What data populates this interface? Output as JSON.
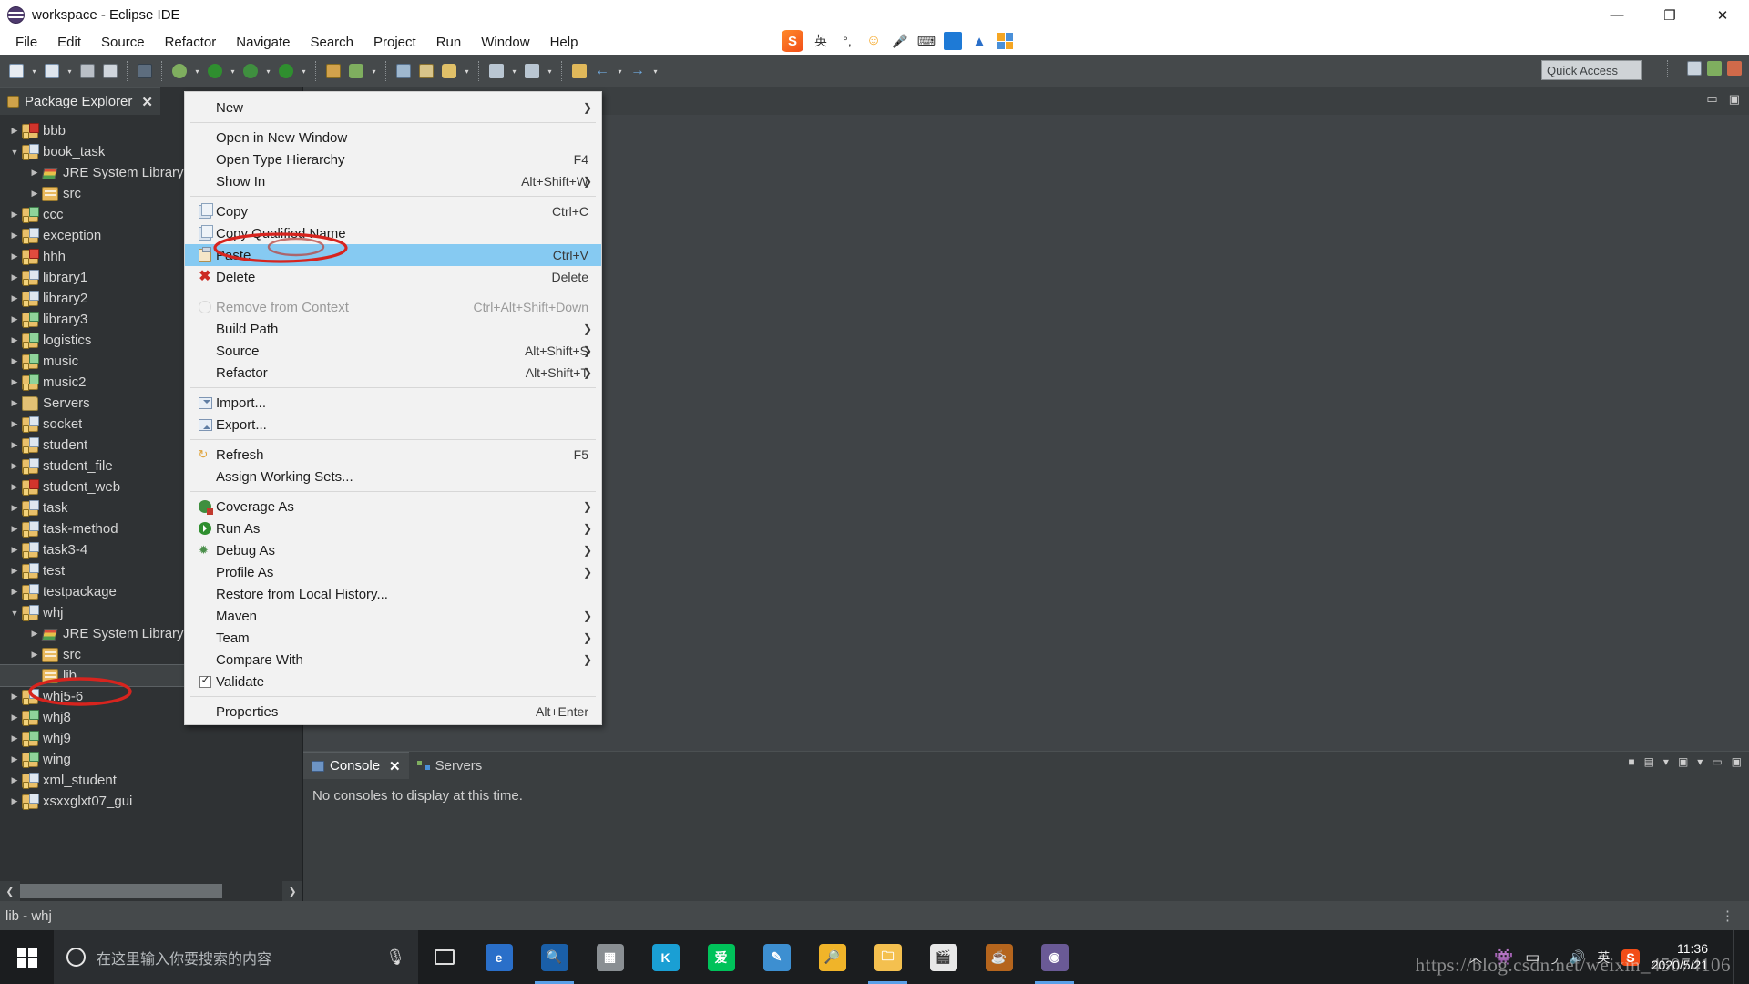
{
  "window": {
    "title": "workspace - Eclipse IDE",
    "minimize": "—",
    "maximize": "❐",
    "close": "✕"
  },
  "menubar": {
    "items": [
      "File",
      "Edit",
      "Source",
      "Refactor",
      "Navigate",
      "Search",
      "Project",
      "Run",
      "Window",
      "Help"
    ]
  },
  "toolbar": {
    "quick_access_placeholder": "Quick Access"
  },
  "ime": {
    "logo": "S",
    "mode": "英",
    "punct": "°,",
    "emoji": "☺",
    "mic": "🎤",
    "keyboard": "⌨",
    "toolbox": "⊞"
  },
  "explorer": {
    "tab_label": "Package Explorer",
    "tab_close": "✕",
    "tree": [
      {
        "label": "bbb",
        "depth": 0,
        "twist": "collapsed",
        "icon": "project-error-icon"
      },
      {
        "label": "book_task",
        "depth": 0,
        "twist": "expanded",
        "icon": "project-icon"
      },
      {
        "label": "JRE System Library",
        "depth": 1,
        "twist": "collapsed",
        "icon": "jre-library-icon"
      },
      {
        "label": "src",
        "depth": 1,
        "twist": "collapsed",
        "icon": "source-folder-icon"
      },
      {
        "label": "ccc",
        "depth": 0,
        "twist": "collapsed",
        "icon": "project-web-icon"
      },
      {
        "label": "exception",
        "depth": 0,
        "twist": "collapsed",
        "icon": "project-icon"
      },
      {
        "label": "hhh",
        "depth": 0,
        "twist": "collapsed",
        "icon": "project-warn-icon"
      },
      {
        "label": "library1",
        "depth": 0,
        "twist": "collapsed",
        "icon": "project-icon"
      },
      {
        "label": "library2",
        "depth": 0,
        "twist": "collapsed",
        "icon": "project-icon"
      },
      {
        "label": "library3",
        "depth": 0,
        "twist": "collapsed",
        "icon": "project-web-icon"
      },
      {
        "label": "logistics",
        "depth": 0,
        "twist": "collapsed",
        "icon": "project-web-icon"
      },
      {
        "label": "music",
        "depth": 0,
        "twist": "collapsed",
        "icon": "project-web-icon"
      },
      {
        "label": "music2",
        "depth": 0,
        "twist": "collapsed",
        "icon": "project-web-icon"
      },
      {
        "label": "Servers",
        "depth": 0,
        "twist": "collapsed",
        "icon": "folder-icon"
      },
      {
        "label": "socket",
        "depth": 0,
        "twist": "collapsed",
        "icon": "project-icon"
      },
      {
        "label": "student",
        "depth": 0,
        "twist": "collapsed",
        "icon": "project-icon"
      },
      {
        "label": "student_file",
        "depth": 0,
        "twist": "collapsed",
        "icon": "project-icon"
      },
      {
        "label": "student_web",
        "depth": 0,
        "twist": "collapsed",
        "icon": "project-error-icon"
      },
      {
        "label": "task",
        "depth": 0,
        "twist": "collapsed",
        "icon": "project-icon"
      },
      {
        "label": "task-method",
        "depth": 0,
        "twist": "collapsed",
        "icon": "project-icon"
      },
      {
        "label": "task3-4",
        "depth": 0,
        "twist": "collapsed",
        "icon": "project-icon"
      },
      {
        "label": "test",
        "depth": 0,
        "twist": "collapsed",
        "icon": "project-icon"
      },
      {
        "label": "testpackage",
        "depth": 0,
        "twist": "collapsed",
        "icon": "project-icon"
      },
      {
        "label": "whj",
        "depth": 0,
        "twist": "expanded",
        "icon": "project-icon"
      },
      {
        "label": "JRE System Library",
        "depth": 1,
        "twist": "collapsed",
        "icon": "jre-library-icon"
      },
      {
        "label": "src",
        "depth": 1,
        "twist": "collapsed",
        "icon": "source-folder-icon"
      },
      {
        "label": "lib",
        "depth": 1,
        "twist": "none",
        "icon": "source-folder-icon",
        "selected": true
      },
      {
        "label": "whj5-6",
        "depth": 0,
        "twist": "collapsed",
        "icon": "project-icon"
      },
      {
        "label": "whj8",
        "depth": 0,
        "twist": "collapsed",
        "icon": "project-web-icon"
      },
      {
        "label": "whj9",
        "depth": 0,
        "twist": "collapsed",
        "icon": "project-web-icon"
      },
      {
        "label": "wing",
        "depth": 0,
        "twist": "collapsed",
        "icon": "project-web-icon"
      },
      {
        "label": "xml_student",
        "depth": 0,
        "twist": "collapsed",
        "icon": "project-icon"
      },
      {
        "label": "xsxxglxt07_gui",
        "depth": 0,
        "twist": "collapsed",
        "icon": "project-icon"
      }
    ],
    "hscroll_left": "❮",
    "hscroll_right": "❯"
  },
  "context_menu": {
    "items": [
      {
        "label": "New",
        "accel": "",
        "submenu": true,
        "icon": "",
        "id": "new"
      },
      {
        "separator": true
      },
      {
        "label": "Open in New Window",
        "accel": "",
        "submenu": false,
        "icon": "",
        "id": "open-in-new-window"
      },
      {
        "label": "Open Type Hierarchy",
        "accel": "F4",
        "submenu": false,
        "icon": "",
        "id": "open-type-hierarchy"
      },
      {
        "label": "Show In",
        "accel": "Alt+Shift+W",
        "submenu": true,
        "icon": "",
        "id": "show-in"
      },
      {
        "separator": true
      },
      {
        "label": "Copy",
        "accel": "Ctrl+C",
        "submenu": false,
        "icon": "copy-icon",
        "id": "copy"
      },
      {
        "label": "Copy Qualified Name",
        "accel": "",
        "submenu": false,
        "icon": "copy-qualified-icon",
        "id": "copy-qualified-name"
      },
      {
        "label": "Paste",
        "accel": "Ctrl+V",
        "submenu": false,
        "icon": "paste-icon",
        "id": "paste",
        "highlighted": true
      },
      {
        "label": "Delete",
        "accel": "Delete",
        "submenu": false,
        "icon": "delete-icon",
        "id": "delete"
      },
      {
        "separator": true
      },
      {
        "label": "Remove from Context",
        "accel": "Ctrl+Alt+Shift+Down",
        "submenu": false,
        "icon": "remove-context-icon",
        "id": "remove-from-context",
        "disabled": true
      },
      {
        "label": "Build Path",
        "accel": "",
        "submenu": true,
        "icon": "",
        "id": "build-path"
      },
      {
        "label": "Source",
        "accel": "Alt+Shift+S",
        "submenu": true,
        "icon": "",
        "id": "source"
      },
      {
        "label": "Refactor",
        "accel": "Alt+Shift+T",
        "submenu": true,
        "icon": "",
        "id": "refactor"
      },
      {
        "separator": true
      },
      {
        "label": "Import...",
        "accel": "",
        "submenu": false,
        "icon": "import-icon",
        "id": "import"
      },
      {
        "label": "Export...",
        "accel": "",
        "submenu": false,
        "icon": "export-icon",
        "id": "export"
      },
      {
        "separator": true
      },
      {
        "label": "Refresh",
        "accel": "F5",
        "submenu": false,
        "icon": "refresh-icon",
        "id": "refresh"
      },
      {
        "label": "Assign Working Sets...",
        "accel": "",
        "submenu": false,
        "icon": "",
        "id": "assign-working-sets"
      },
      {
        "separator": true
      },
      {
        "label": "Coverage As",
        "accel": "",
        "submenu": true,
        "icon": "coverage-icon",
        "id": "coverage-as"
      },
      {
        "label": "Run As",
        "accel": "",
        "submenu": true,
        "icon": "run-icon",
        "id": "run-as"
      },
      {
        "label": "Debug As",
        "accel": "",
        "submenu": true,
        "icon": "debug-icon",
        "id": "debug-as"
      },
      {
        "label": "Profile As",
        "accel": "",
        "submenu": true,
        "icon": "",
        "id": "profile-as"
      },
      {
        "label": "Restore from Local History...",
        "accel": "",
        "submenu": false,
        "icon": "",
        "id": "restore-local-history"
      },
      {
        "label": "Maven",
        "accel": "",
        "submenu": true,
        "icon": "",
        "id": "maven"
      },
      {
        "label": "Team",
        "accel": "",
        "submenu": true,
        "icon": "",
        "id": "team"
      },
      {
        "label": "Compare With",
        "accel": "",
        "submenu": true,
        "icon": "",
        "id": "compare-with"
      },
      {
        "label": "Validate",
        "accel": "",
        "submenu": false,
        "icon": "checkbox-checked-icon",
        "id": "validate"
      },
      {
        "separator": true
      },
      {
        "label": "Properties",
        "accel": "Alt+Enter",
        "submenu": false,
        "icon": "",
        "id": "properties"
      }
    ]
  },
  "console_panel": {
    "tabs": [
      {
        "label": "Console",
        "active": true,
        "close": "✕",
        "icon": "console-icon"
      },
      {
        "label": "Servers",
        "active": false,
        "close": "",
        "icon": "servers-icon"
      }
    ],
    "message": "No consoles to display at this time."
  },
  "statusbar": {
    "text": "lib - whj",
    "right_text": "⋮"
  },
  "taskbar": {
    "search_placeholder": "在这里输入你要搜索的内容",
    "apps": [
      {
        "name": "edge-browser",
        "glyph": "e",
        "color": "#2a6fc9",
        "active": false
      },
      {
        "name": "magnifier-app",
        "glyph": "🔍",
        "color": "#1a5fa8",
        "active": true
      },
      {
        "name": "calculator-app",
        "glyph": "▦",
        "color": "#8a8f93",
        "active": false
      },
      {
        "name": "kugou-app",
        "glyph": "K",
        "color": "#1a9fd4",
        "active": false
      },
      {
        "name": "iqiyi-app",
        "glyph": "爱",
        "color": "#00c25a",
        "active": false
      },
      {
        "name": "notes-app",
        "glyph": "✎",
        "color": "#3d8fd1",
        "active": false
      },
      {
        "name": "search-app",
        "glyph": "🔎",
        "color": "#f0b429",
        "active": false
      },
      {
        "name": "explorer-app",
        "glyph": "🗀",
        "color": "#f4c04f",
        "active": true
      },
      {
        "name": "video-app",
        "glyph": "🎬",
        "color": "#e8e8e8",
        "active": false
      },
      {
        "name": "java-app",
        "glyph": "☕",
        "color": "#b5651d",
        "active": false
      },
      {
        "name": "eclipse-app",
        "glyph": "◉",
        "color": "#6a5a96",
        "active": true
      }
    ],
    "tray": {
      "chevron": "︿",
      "battery": "▭",
      "wifi": "◞",
      "volume": "🔊",
      "ime_mode": "英",
      "sogou": "S"
    },
    "clock_time": "11:36",
    "clock_date": "2020/5/21"
  },
  "watermark": "https://blog.csdn.net/weixin_45074106",
  "colors": {
    "menu_highlight": "#86caf2",
    "annotation_red": "#d7241e",
    "panel_bg": "#2f3234",
    "toolbar_bg": "#45494b"
  }
}
